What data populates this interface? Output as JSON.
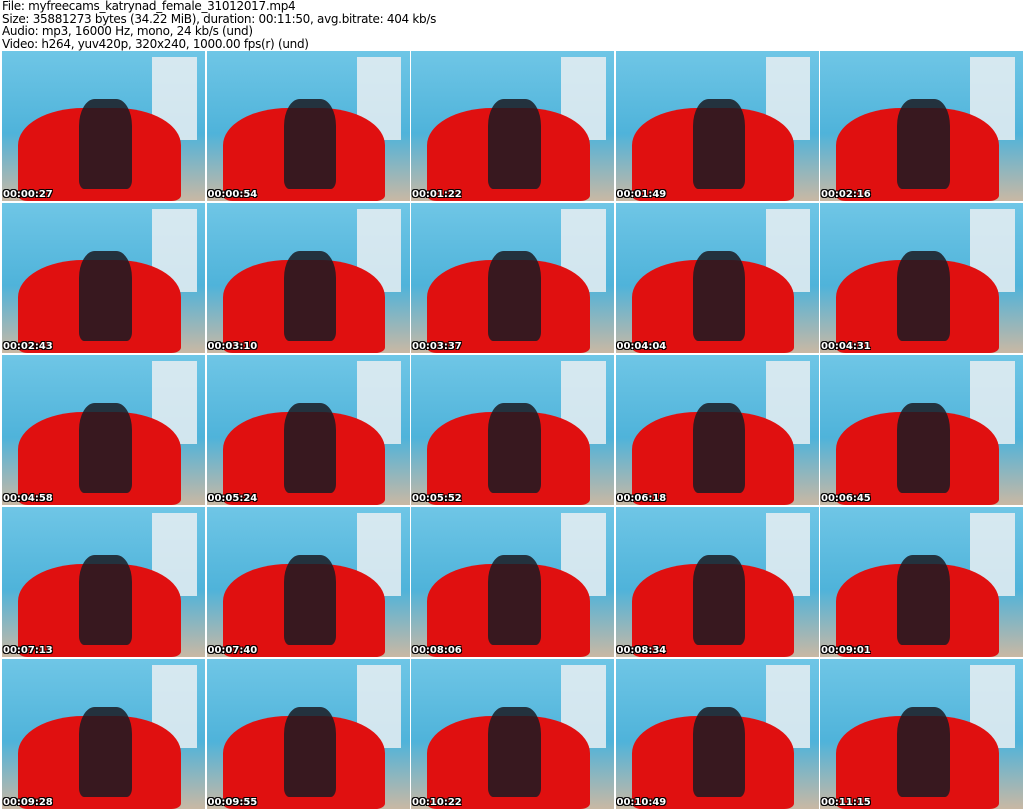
{
  "header": {
    "file": "File: myfreecams_katrynad_female_31012017.mp4",
    "size": "Size: 35881273 bytes (34.22 MiB), duration: 00:11:50, avg.bitrate: 404 kb/s",
    "audio": "Audio: mp3, 16000 Hz, mono, 24 kb/s (und)",
    "video": "Video: h264, yuv420p, 320x240, 1000.00 fps(r) (und)"
  },
  "thumbnails": [
    "00:00:27",
    "00:00:54",
    "00:01:22",
    "00:01:49",
    "00:02:16",
    "00:02:43",
    "00:03:10",
    "00:03:37",
    "00:04:04",
    "00:04:31",
    "00:04:58",
    "00:05:24",
    "00:05:52",
    "00:06:18",
    "00:06:45",
    "00:07:13",
    "00:07:40",
    "00:08:06",
    "00:08:34",
    "00:09:01",
    "00:09:28",
    "00:09:55",
    "00:10:22",
    "00:10:49",
    "00:11:15"
  ]
}
